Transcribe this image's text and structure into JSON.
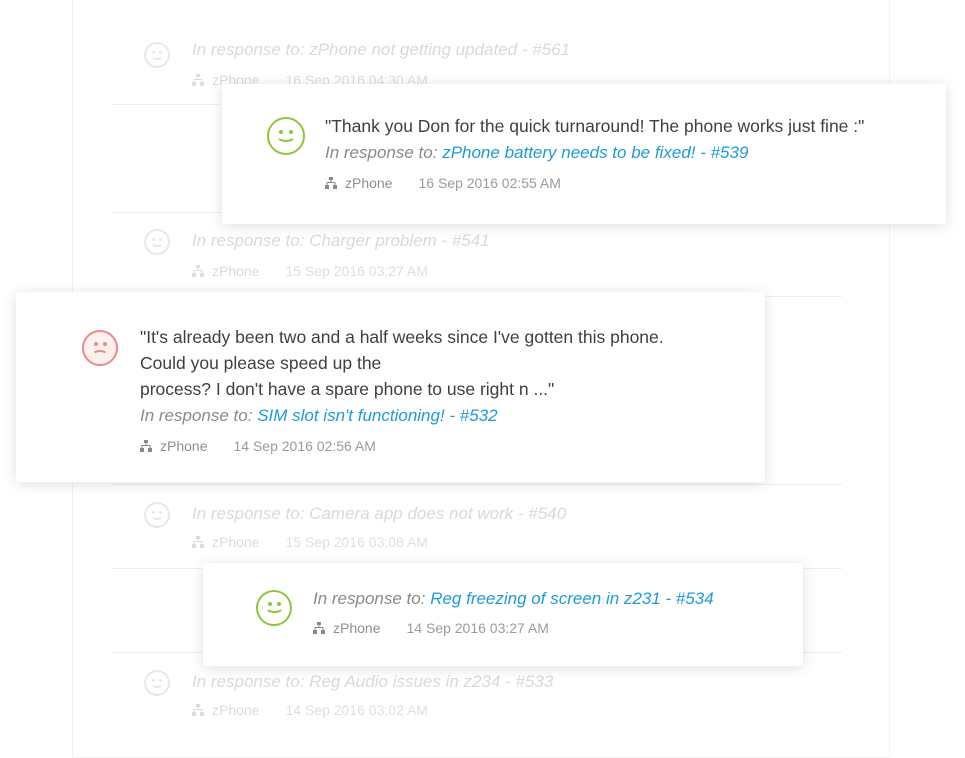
{
  "background_rows": [
    {
      "prefix": "In response to: ",
      "subject": "zPhone not getting updated - #561",
      "department": "zPhone",
      "date": "16 Sep 2016 04:30 AM"
    },
    {
      "prefix": "In response to: ",
      "subject": "Charger problem - #541",
      "department": "zPhone",
      "date": "15 Sep 2016 03:27 AM"
    },
    {
      "prefix": "In response to: ",
      "subject": "Camera app does not work - #540",
      "department": "zPhone",
      "date": "15 Sep 2016 03:08 AM"
    },
    {
      "prefix": "In response to: ",
      "subject": "Reg Audio issues in z234 - #533",
      "department": "zPhone",
      "date": "14 Sep 2016 03:02 AM"
    }
  ],
  "cards": [
    {
      "rating": "happy",
      "icon": "smiley-happy-icon",
      "quote_lines": [
        "\"Thank you Don for the quick turnaround! The phone works just fine :\""
      ],
      "prefix": "In response to: ",
      "subject": "zPhone battery needs to be fixed! - #539",
      "department": "zPhone",
      "date": "16 Sep 2016 02:55 AM"
    },
    {
      "rating": "sad",
      "icon": "smiley-sad-icon",
      "quote_lines": [
        "\"It's already been two and a half weeks since I've gotten this phone.",
        "Could you please speed up the",
        "process? I don't have a spare phone to use right n ...\""
      ],
      "prefix": "In response to: ",
      "subject": "SIM slot isn't functioning! - #532",
      "department": "zPhone",
      "date": "14 Sep 2016 02:56 AM"
    },
    {
      "rating": "happy",
      "icon": "smiley-happy-icon",
      "quote_lines": [],
      "prefix": "In response to: ",
      "subject": "Reg freezing of screen in z231 - #534",
      "department": "zPhone",
      "date": "14 Sep 2016 03:27 AM"
    }
  ],
  "colors": {
    "link": "#1e9ad6",
    "happy": "#8cc63f",
    "sad": "#e88a86",
    "muted": "#8a8a8a"
  }
}
